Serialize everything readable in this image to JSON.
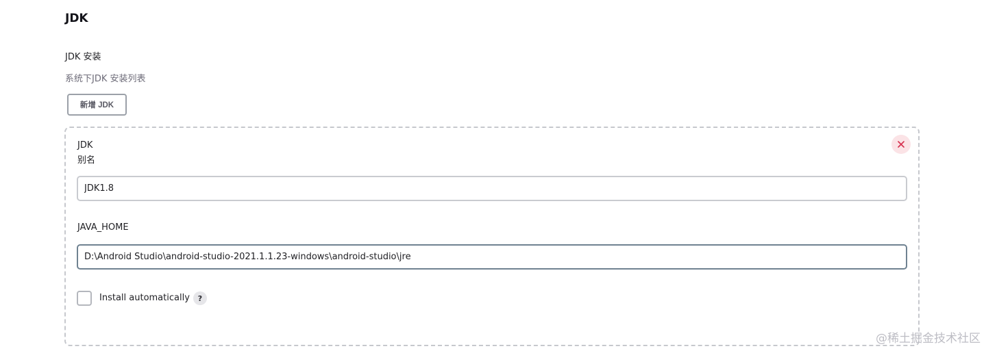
{
  "section": {
    "title": "JDK"
  },
  "installations": {
    "label": "JDK 安装",
    "description": "系统下JDK 安装列表",
    "add_button": "新增 JDK"
  },
  "jdk_entry": {
    "title": "JDK",
    "name_label": "别名",
    "name_value": "JDK1.8",
    "java_home_label": "JAVA_HOME",
    "java_home_value": "D:\\Android Studio\\android-studio-2021.1.1.23-windows\\android-studio\\jre",
    "install_auto_label": "Install automatically",
    "install_auto_checked": false,
    "help_glyph": "?",
    "delete_icon": "close-icon"
  },
  "watermark": "@稀土掘金技术社区",
  "colors": {
    "delete_bg": "#fbe3e6",
    "delete_icon": "#d6304e",
    "focused_input_border": "#6f8291"
  }
}
